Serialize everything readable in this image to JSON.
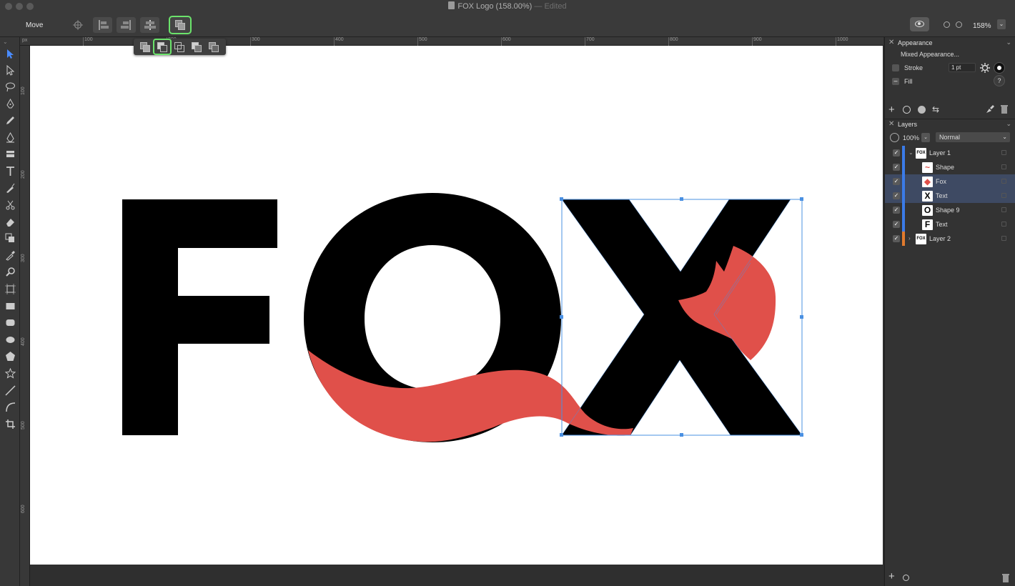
{
  "window": {
    "title": "FOX Logo (158.00%)",
    "separator": "—",
    "status": "Edited"
  },
  "toolbar": {
    "tool_name": "Move",
    "zoom_value": "158%",
    "zoom_dropdown": "⌄"
  },
  "ruler": {
    "unit": "px",
    "top_labels": [
      "100",
      "200",
      "300",
      "400",
      "500",
      "600",
      "700",
      "800",
      "900",
      "1000"
    ],
    "left_labels": [
      "100",
      "200",
      "300",
      "400",
      "500",
      "600",
      "700"
    ]
  },
  "canvas": {
    "logo_letters": [
      "F",
      "O",
      "X"
    ],
    "colors": {
      "black": "#000000",
      "fox_red": "#e0504a",
      "selection": "#4a90e2",
      "artboard": "#ffffff"
    }
  },
  "appearance": {
    "header": "Appearance",
    "mixed_label": "Mixed Appearance...",
    "stroke_label": "Stroke",
    "stroke_width": "1 pt",
    "fill_label": "Fill",
    "help_label": "?"
  },
  "layers": {
    "header": "Layers",
    "opacity": "100%",
    "blend_mode": "Normal",
    "items": [
      {
        "name": "Layer 1",
        "thumb": "FOX",
        "selected": false,
        "color": "#3b7be8"
      },
      {
        "name": "Shape",
        "thumb": "~",
        "selected": false,
        "color": "#3b7be8"
      },
      {
        "name": "Fox",
        "thumb": "◆",
        "selected": true,
        "color": "#3b7be8"
      },
      {
        "name": "Text",
        "thumb": "X",
        "selected": true,
        "color": "#3b7be8"
      },
      {
        "name": "Shape 9",
        "thumb": "O",
        "selected": false,
        "color": "#3b7be8"
      },
      {
        "name": "Text",
        "thumb": "F",
        "selected": false,
        "color": "#3b7be8"
      },
      {
        "name": "Layer 2",
        "thumb": "FOX",
        "selected": false,
        "color": "#e07a2e"
      }
    ]
  },
  "icons": {
    "checkmark": "✓",
    "close": "✕",
    "chevron": "⌄",
    "disclosure_open": "⌄",
    "disclosure_closed": "›"
  }
}
